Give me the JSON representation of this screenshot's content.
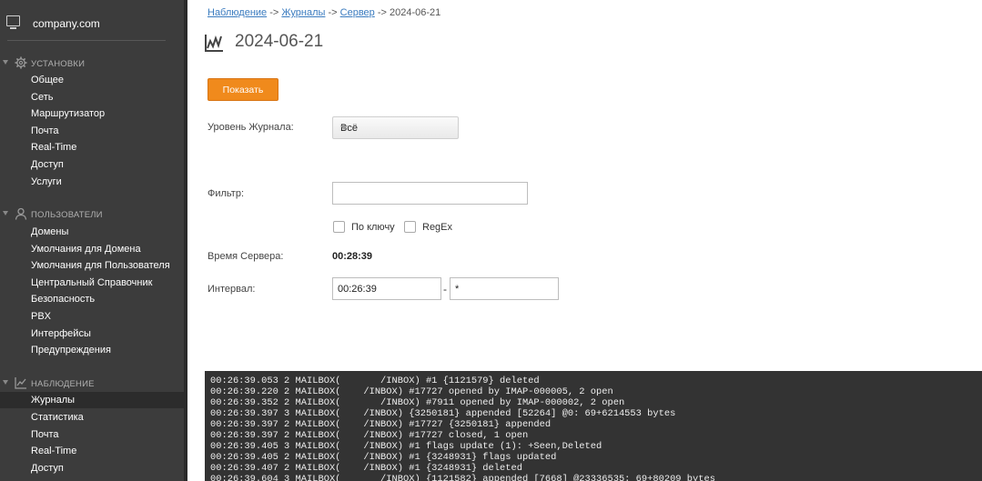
{
  "sidebar": {
    "brand": "company.com",
    "sections": [
      {
        "title": "УСТАНОВКИ",
        "icon": "gear-icon",
        "items": [
          "Общее",
          "Сеть",
          "Маршрутизатор",
          "Почта",
          "Real-Time",
          "Доступ",
          "Услуги"
        ]
      },
      {
        "title": "ПОЛЬЗОВАТЕЛИ",
        "icon": "user-icon",
        "items": [
          "Домены",
          "Умолчания для Домена",
          "Умолчания для Пользователя",
          "Центральный Справочник",
          "Безопасность",
          "PBX",
          "Интерфейсы",
          "Предупреждения"
        ]
      },
      {
        "title": "НАБЛЮДЕНИЕ",
        "icon": "chart-icon",
        "items": [
          "Журналы",
          "Статистика",
          "Почта",
          "Real-Time",
          "Доступ"
        ],
        "active": "Журналы"
      }
    ]
  },
  "breadcrumb": {
    "items": [
      "Наблюдение",
      "Журналы",
      "Сервер"
    ],
    "separator": "->",
    "current": "2024-06-21"
  },
  "page": {
    "title": "2024-06-21",
    "icon": "chart-icon"
  },
  "form": {
    "show_button": "Показать",
    "log_level": {
      "label": "Уровень Журнала:",
      "value": "Всё"
    },
    "filter": {
      "label": "Фильтр:",
      "value": ""
    },
    "by_key": {
      "label": "По ключу",
      "checked": false
    },
    "regex": {
      "label": "RegEx",
      "checked": false
    },
    "server_time": {
      "label": "Время Сервера:",
      "value": "00:28:39"
    },
    "interval": {
      "label": "Интервал:",
      "from": "00:26:39",
      "separator": "-",
      "to": "*"
    }
  },
  "log_lines": [
    "00:26:39.053 2 MAILBOX(       /INBOX) #1 {1121579} deleted",
    "00:26:39.220 2 MAILBOX(    /INBOX) #17727 opened by IMAP-000005, 2 open",
    "00:26:39.352 2 MAILBOX(       /INBOX) #7911 opened by IMAP-000002, 2 open",
    "00:26:39.397 3 MAILBOX(    /INBOX) {3250181} appended [52264] @0: 69+6214553 bytes",
    "00:26:39.397 2 MAILBOX(    /INBOX) #17727 {3250181} appended",
    "00:26:39.397 2 MAILBOX(    /INBOX) #17727 closed, 1 open",
    "00:26:39.405 3 MAILBOX(    /INBOX) #1 flags update (1): +Seen,Deleted",
    "00:26:39.405 2 MAILBOX(    /INBOX) #1 {3248931} flags updated",
    "00:26:39.407 2 MAILBOX(    /INBOX) #1 {3248931} deleted",
    "00:26:39.604 3 MAILBOX(       /INBOX) {1121582} appended [7668] @23336535: 69+80209 bytes"
  ],
  "colors": {
    "sidebar_bg": "#3c3c3c",
    "accent": "#f08a1c",
    "log_bg": "#333333",
    "link": "#3a7bbf"
  }
}
